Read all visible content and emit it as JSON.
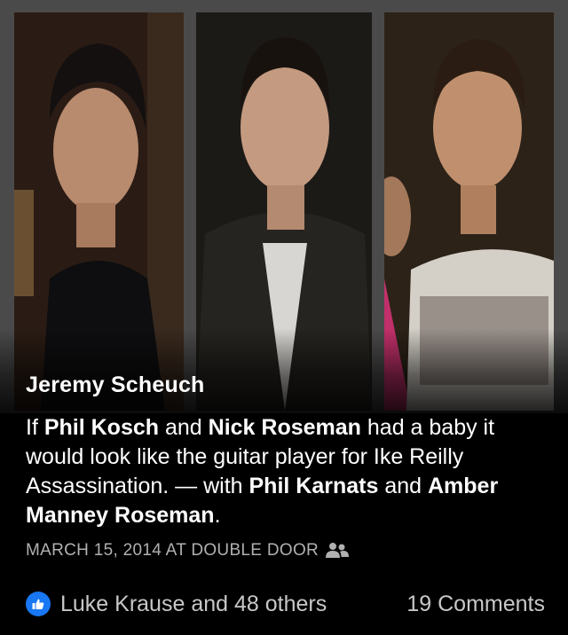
{
  "post": {
    "author": "Jeremy Scheuch",
    "caption": {
      "t1": "If ",
      "tag1": "Phil Kosch",
      "t2": " and ",
      "tag2": "Nick Roseman",
      "t3": " had a baby it would look like the guitar player for Ike Reilly Assassination. — with ",
      "tag3": "Phil Karnats",
      "t4": " and ",
      "tag4": "Amber Manney Roseman",
      "t5": "."
    },
    "meta": "MARCH 15, 2014 AT DOUBLE DOOR",
    "privacy_icon": "friends-icon"
  },
  "reactions": {
    "likes_text": "Luke Krause and 48 others",
    "comments_text": "19 Comments",
    "like_icon": "thumbs-up-icon"
  },
  "colors": {
    "background": "#000000",
    "photo_frame": "#4a4a4a",
    "like_blue": "#1877f2",
    "meta_gray": "#b0b0b0"
  }
}
